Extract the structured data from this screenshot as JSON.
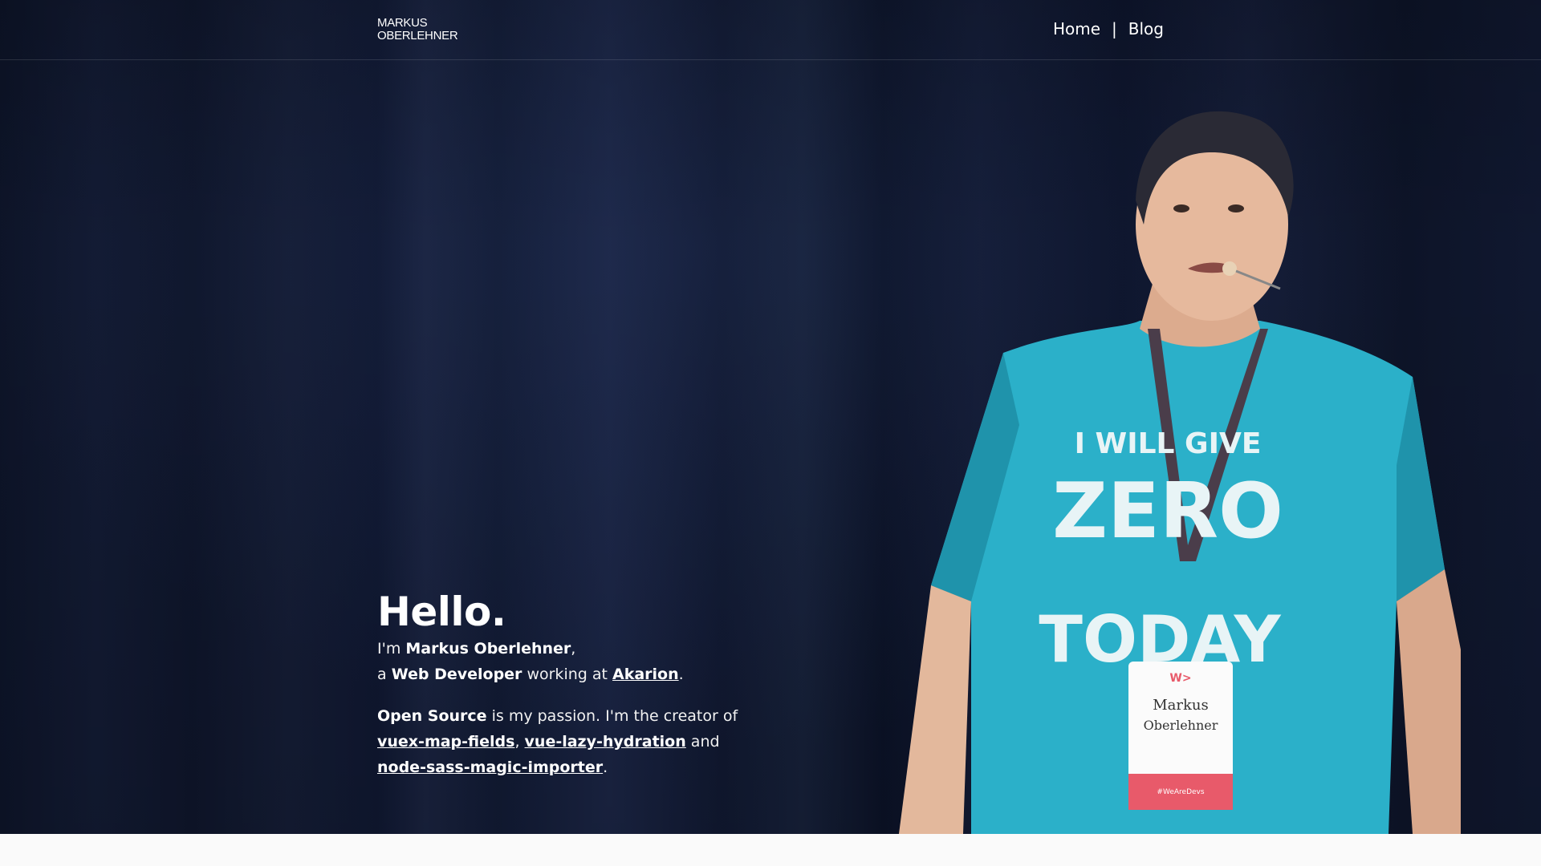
{
  "header": {
    "logo_line1": "MARKUS",
    "logo_line2": "OBERLEHNER",
    "nav": {
      "home": "Home",
      "separator": "|",
      "blog": "Blog"
    }
  },
  "hero": {
    "greeting": "Hello.",
    "line1_prefix": "I'm ",
    "name": "Markus Oberlehner",
    "line1_suffix": ",",
    "line2_prefix": "a ",
    "role": "Web Developer",
    "line2_middle": " working at ",
    "company": "Akarion",
    "line2_suffix": ".",
    "para2_bold": "Open Source",
    "para2_text1": " is my passion. I'm the creator of ",
    "project1": "vuex-map-fields",
    "comma": ", ",
    "project2": "vue-lazy-hydration",
    "and": " and ",
    "project3": "node-sass-magic-importer",
    "period": "."
  },
  "photo": {
    "shirt_line1": "I WILL GIVE",
    "shirt_line2": "ZERO",
    "shirt_line3": "TODAY",
    "badge_name": "Markus Oberlehner",
    "badge_logo": "W>",
    "badge_footer": "#WeAreDevs"
  },
  "colors": {
    "background": "#0e152b",
    "shirt": "#2bb0c9",
    "badge_red": "#e85a6a",
    "page_bottom": "#fafafa"
  }
}
